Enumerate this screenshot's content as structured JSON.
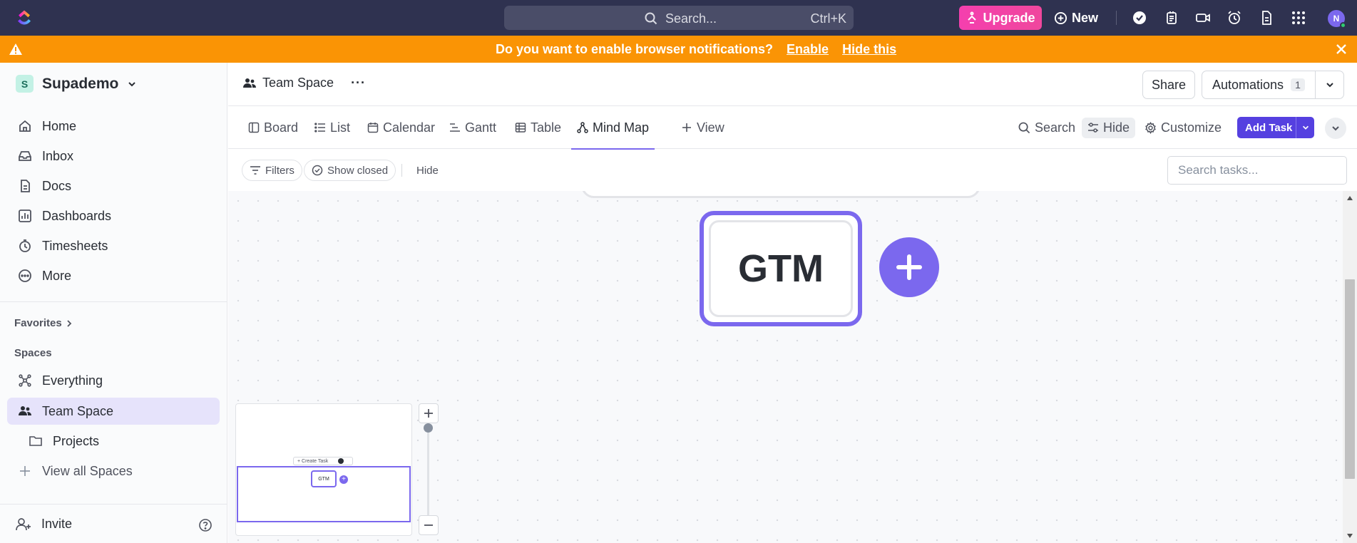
{
  "topbar": {
    "search_placeholder": "Search...",
    "search_shortcut": "Ctrl+K",
    "upgrade_label": "Upgrade",
    "new_label": "New",
    "avatar_initial": "N"
  },
  "notification": {
    "message": "Do you want to enable browser notifications?",
    "enable_label": "Enable",
    "hide_label": "Hide this"
  },
  "sidebar": {
    "workspace_badge": "S",
    "workspace_name": "Supademo",
    "nav": [
      {
        "label": "Home",
        "icon": "home-icon"
      },
      {
        "label": "Inbox",
        "icon": "inbox-icon"
      },
      {
        "label": "Docs",
        "icon": "docs-icon"
      },
      {
        "label": "Dashboards",
        "icon": "dashboards-icon"
      },
      {
        "label": "Timesheets",
        "icon": "timer-icon"
      },
      {
        "label": "More",
        "icon": "more-icon"
      }
    ],
    "favorites_label": "Favorites",
    "spaces_label": "Spaces",
    "spaces": [
      {
        "label": "Everything",
        "icon": "everything-icon"
      },
      {
        "label": "Team Space",
        "icon": "team-icon",
        "active": true
      },
      {
        "label": "Projects",
        "icon": "folder-icon"
      },
      {
        "label": "View all Spaces",
        "icon": "plus-icon"
      }
    ],
    "invite_label": "Invite"
  },
  "header": {
    "breadcrumb": "Team Space",
    "share_label": "Share",
    "automations_label": "Automations",
    "automations_count": "1"
  },
  "tabs": [
    {
      "label": "Board",
      "icon": "board-icon"
    },
    {
      "label": "List",
      "icon": "list-icon"
    },
    {
      "label": "Calendar",
      "icon": "calendar-icon"
    },
    {
      "label": "Gantt",
      "icon": "gantt-icon"
    },
    {
      "label": "Table",
      "icon": "table-icon"
    },
    {
      "label": "Mind Map",
      "icon": "mindmap-icon",
      "active": true
    },
    {
      "label": "View",
      "icon": "plus-icon"
    }
  ],
  "tools": {
    "search_label": "Search",
    "hide_label": "Hide",
    "customize_label": "Customize",
    "add_task_label": "Add Task"
  },
  "filters": {
    "filters_label": "Filters",
    "show_closed_label": "Show closed",
    "hide_label": "Hide",
    "task_search_placeholder": "Search tasks..."
  },
  "mindmap": {
    "node_label": "GTM",
    "minimap_create_label": "+ Create Task",
    "minimap_node_label": "GTM"
  },
  "colors": {
    "topbar_bg": "#2f3250",
    "notification_bg": "#fa9405",
    "accent": "#7b68ee",
    "add_task_bg": "#5540e0",
    "upgrade_bg": "#f43fae"
  }
}
